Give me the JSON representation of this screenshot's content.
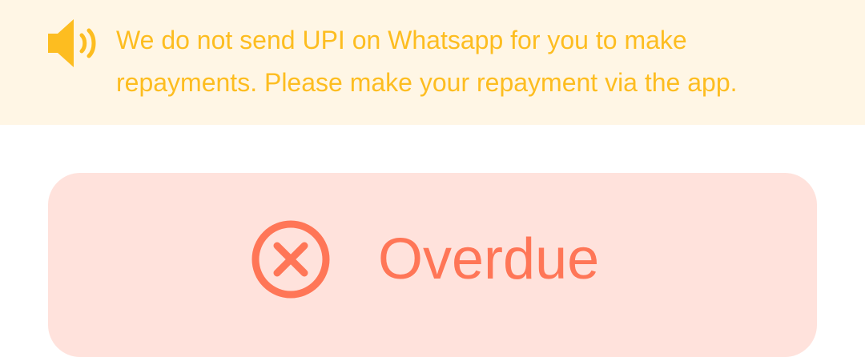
{
  "notice": {
    "icon": "speaker-icon",
    "text": "We do not send UPI on Whatsapp for you to make\nrepayments. Please make your repayment via the app.",
    "color": "#FDBD20",
    "background": "#FFF6E5"
  },
  "status": {
    "icon": "close-circle-icon",
    "label": "Overdue",
    "color": "#FF7657",
    "background": "#FFE2DC"
  }
}
